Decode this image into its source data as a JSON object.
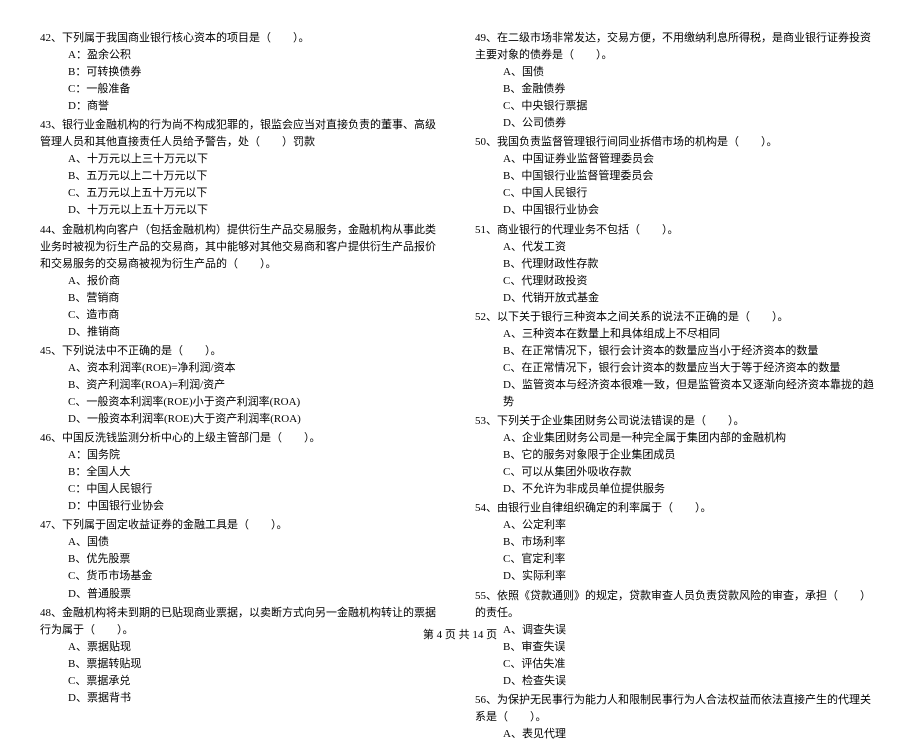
{
  "footer": "第 4 页 共 14 页",
  "left": {
    "q42": {
      "text": "42、下列属于我国商业银行核心资本的项目是（　　）。",
      "a": "A：盈余公积",
      "b": "B：可转换债券",
      "c": "C：一般准备",
      "d": "D：商誉"
    },
    "q43": {
      "text": "43、银行业金融机构的行为尚不构成犯罪的，银监会应当对直接负责的董事、高级管理人员和其他直接责任人员给予警告，处（　　）罚款",
      "a": "A、十万元以上三十万元以下",
      "b": "B、五万元以上二十万元以下",
      "c": "C、五万元以上五十万元以下",
      "d": "D、十万元以上五十万元以下"
    },
    "q44": {
      "text": "44、金融机构向客户（包括金融机构）提供衍生产品交易服务，金融机构从事此类业务时被视为衍生产品的交易商，其中能够对其他交易商和客户提供衍生产品报价和交易服务的交易商被视为衍生产品的（　　）。",
      "a": "A、报价商",
      "b": "B、营销商",
      "c": "C、造市商",
      "d": "D、推销商"
    },
    "q45": {
      "text": "45、下列说法中不正确的是（　　）。",
      "a": "A、资本利润率(ROE)=净利润/资本",
      "b": "B、资产利润率(ROA)=利润/资产",
      "c": "C、一般资本利润率(ROE)小于资产利润率(ROA)",
      "d": "D、一般资本利润率(ROE)大于资产利润率(ROA)"
    },
    "q46": {
      "text": "46、中国反洗钱监测分析中心的上级主管部门是（　　）。",
      "a": "A：国务院",
      "b": "B：全国人大",
      "c": "C：中国人民银行",
      "d": "D：中国银行业协会"
    },
    "q47": {
      "text": "47、下列属于固定收益证券的金融工具是（　　）。",
      "a": "A、国债",
      "b": "B、优先股票",
      "c": "C、货币市场基金",
      "d": "D、普通股票"
    },
    "q48": {
      "text": "48、金融机构将未到期的已贴现商业票据，以卖断方式向另一金融机构转让的票据行为属于（　　）。",
      "a": "A、票据贴现",
      "b": "B、票据转贴现",
      "c": "C、票据承兑",
      "d": "D、票据背书"
    }
  },
  "right": {
    "q49": {
      "text": "49、在二级市场非常发达，交易方便，不用缴纳利息所得税，是商业银行证券投资主要对象的债券是（　　）。",
      "a": "A、国债",
      "b": "B、金融债券",
      "c": "C、中央银行票据",
      "d": "D、公司债券"
    },
    "q50": {
      "text": "50、我国负责监督管理银行间同业拆借市场的机构是（　　）。",
      "a": "A、中国证券业监督管理委员会",
      "b": "B、中国银行业监督管理委员会",
      "c": "C、中国人民银行",
      "d": "D、中国银行业协会"
    },
    "q51": {
      "text": "51、商业银行的代理业务不包括（　　）。",
      "a": "A、代发工资",
      "b": "B、代理财政性存款",
      "c": "C、代理财政投资",
      "d": "D、代销开放式基金"
    },
    "q52": {
      "text": "52、以下关于银行三种资本之间关系的说法不正确的是（　　）。",
      "a": "A、三种资本在数量上和具体组成上不尽相同",
      "b": "B、在正常情况下，银行会计资本的数量应当小于经济资本的数量",
      "c": "C、在正常情况下，银行会计资本的数量应当大于等于经济资本的数量",
      "d": "D、监管资本与经济资本很难一致，但是监管资本又逐渐向经济资本靠拢的趋势"
    },
    "q53": {
      "text": "53、下列关于企业集团财务公司说法错误的是（　　）。",
      "a": "A、企业集团财务公司是一种完全属于集团内部的金融机构",
      "b": "B、它的服务对象限于企业集团成员",
      "c": "C、可以从集团外吸收存款",
      "d": "D、不允许为非成员单位提供服务"
    },
    "q54": {
      "text": "54、由银行业自律组织确定的利率属于（　　）。",
      "a": "A、公定利率",
      "b": "B、市场利率",
      "c": "C、官定利率",
      "d": "D、实际利率"
    },
    "q55": {
      "text": "55、依照《贷款通则》的规定，贷款审查人员负责贷款风险的审查，承担（　　）的责任。",
      "a": "A、调查失误",
      "b": "B、审查失误",
      "c": "C、评估失准",
      "d": "D、检查失误"
    },
    "q56": {
      "text": "56、为保护无民事行为能力人和限制民事行为人合法权益而依法直接产生的代理关系是（　　）。",
      "a": "A、表见代理"
    }
  }
}
